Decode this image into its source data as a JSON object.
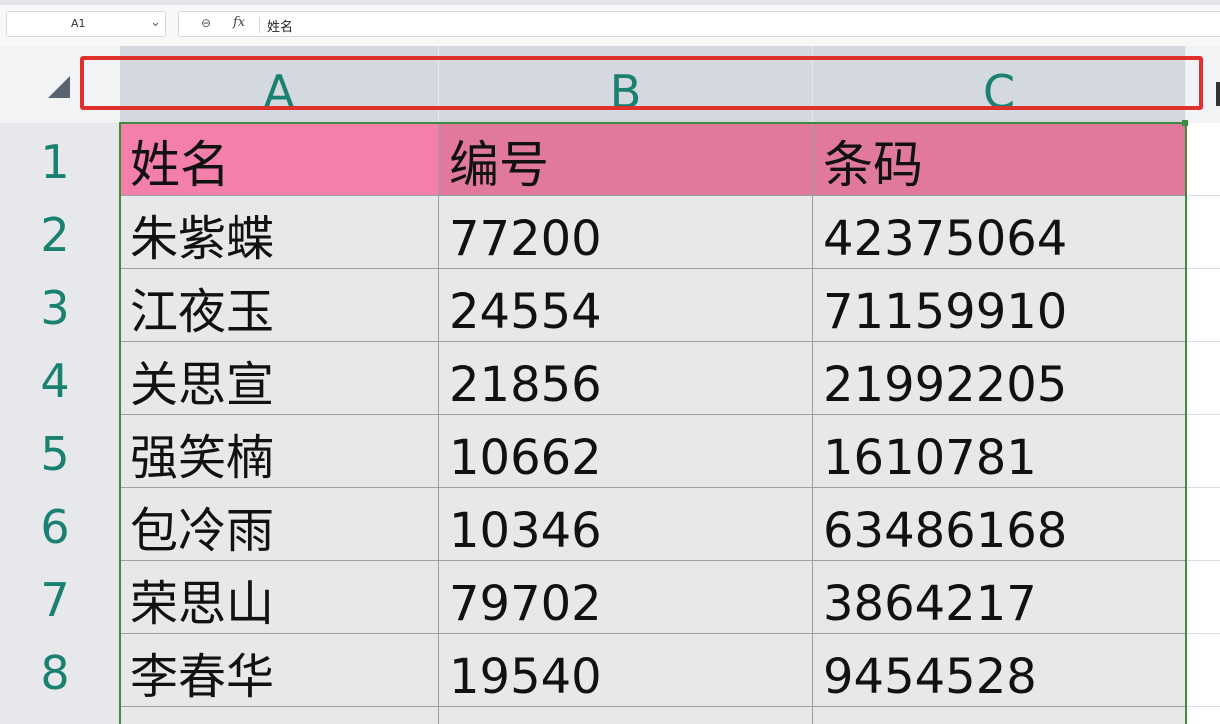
{
  "formula_bar": {
    "name_box": "A1",
    "formula_value": "姓名",
    "fx_label": "fx",
    "zoom_icon": "zoom-icon"
  },
  "columns": [
    "A",
    "B",
    "C"
  ],
  "rows": [
    "1",
    "2",
    "3",
    "4",
    "5",
    "6",
    "7",
    "8"
  ],
  "headers": [
    "姓名",
    "编号",
    "条码"
  ],
  "data": [
    [
      "朱紫蝶",
      "77200",
      "42375064"
    ],
    [
      "江夜玉",
      "24554",
      "71159910"
    ],
    [
      "关思宣",
      "21856",
      "21992205"
    ],
    [
      "强笑楠",
      "10662",
      "1610781"
    ],
    [
      "包冷雨",
      "10346",
      "63486168"
    ],
    [
      "荣思山",
      "79702",
      "3864217"
    ],
    [
      "李春华",
      "19540",
      "9454528"
    ]
  ],
  "colors": {
    "header_a": "#f47fab",
    "header_bc": "#e0799c",
    "highlight": "#e0302b",
    "selection": "#3d8b3d",
    "header_text": "#1a8070"
  }
}
